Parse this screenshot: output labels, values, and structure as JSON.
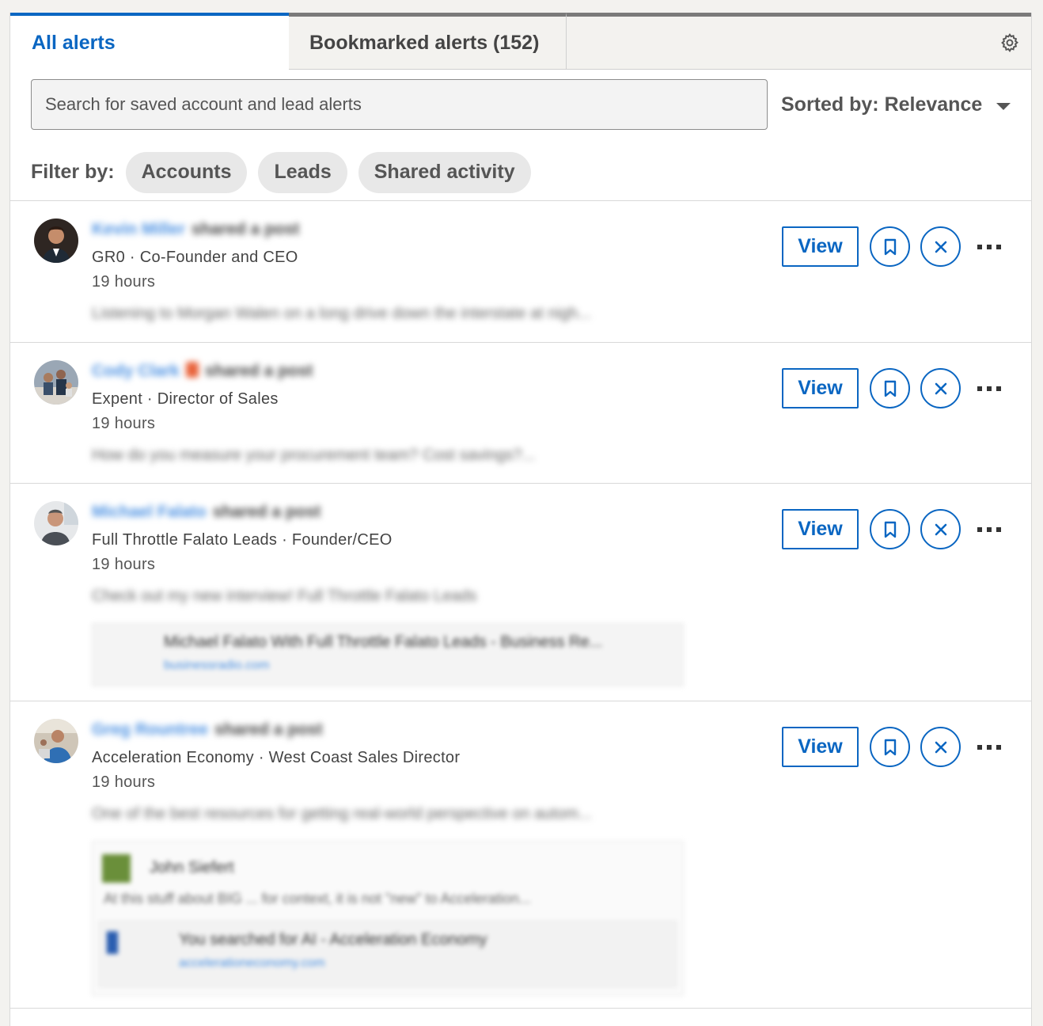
{
  "tabs": {
    "all_alerts": "All alerts",
    "bookmarked_alerts": "Bookmarked alerts (152)"
  },
  "search": {
    "placeholder": "Search for saved account and lead alerts"
  },
  "sort": {
    "label": "Sorted by: Relevance"
  },
  "filter": {
    "label": "Filter by:",
    "pills": [
      "Accounts",
      "Leads",
      "Shared activity"
    ]
  },
  "actions": {
    "view_label": "View"
  },
  "alerts": [
    {
      "name": "Kevin Miller",
      "verb": "shared a post",
      "company_title": "GR0 · Co-Founder and CEO",
      "time": "19 hours",
      "snippet": "Listening to Morgan Walen on a long drive down the interstate at nigh..."
    },
    {
      "name": "Cody Clark",
      "verb": "shared a post",
      "company_title": "Expent · Director of Sales",
      "time": "19 hours",
      "snippet": "How do you measure your procurement team? Cost savings?..."
    },
    {
      "name": "Michael Falato",
      "verb": "shared a post",
      "company_title": "Full Throttle Falato Leads · Founder/CEO",
      "time": "19 hours",
      "snippet": "Check out my new interview! Full Throttle Falato Leads",
      "preview_title": "Michael Falato With Full Throttle Falato Leads - Business Re...",
      "preview_link": "businessradio.com"
    },
    {
      "name": "Greg Rountree",
      "verb": "shared a post",
      "company_title": "Acceleration Economy · West Coast Sales Director",
      "time": "19 hours",
      "snippet": "One of the best resources for getting real-world perspective on autom...",
      "preview_author": "John Siefert",
      "preview_quote": "At this stuff about BIG ... for context, it is not \"new\" to Acceleration...",
      "preview_title": "You searched for AI - Acceleration Economy",
      "preview_link": "accelerationeconomy.com"
    }
  ]
}
